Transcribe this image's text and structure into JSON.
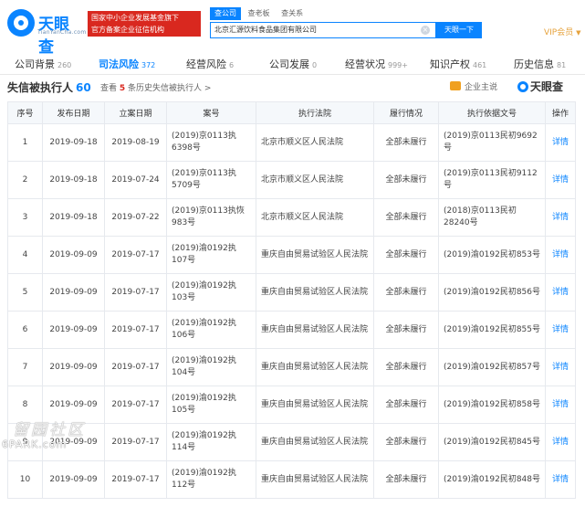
{
  "header": {
    "logo_text": "天眼查",
    "logo_sub": "TianYanCha.com",
    "badge_line1": "国家中小企业发展基金旗下",
    "badge_line2": "官方备案企业征信机构",
    "search_tabs": [
      "查公司",
      "查老板",
      "查关系"
    ],
    "search_value": "北京汇源饮料食品集团有限公司",
    "search_button": "天眼一下",
    "vip": "VIP会员"
  },
  "nav": [
    {
      "label": "公司背景",
      "count": "260"
    },
    {
      "label": "司法风险",
      "count": "372"
    },
    {
      "label": "经营风险",
      "count": "6"
    },
    {
      "label": "公司发展",
      "count": "0"
    },
    {
      "label": "经营状况",
      "count": "999+"
    },
    {
      "label": "知识产权",
      "count": "461"
    },
    {
      "label": "历史信息",
      "count": "81"
    }
  ],
  "section": {
    "title": "失信被执行人",
    "count": "60",
    "hist_pre": "查看",
    "hist_num": "5",
    "hist_post": "条历史失信被执行人 >",
    "enterprise_main": "企业主说",
    "brand": "天眼查"
  },
  "table": {
    "headers": [
      "序号",
      "发布日期",
      "立案日期",
      "案号",
      "执行法院",
      "履行情况",
      "执行依据文号",
      "操作"
    ],
    "rows": [
      {
        "no": "1",
        "pub": "2019-09-18",
        "reg": "2019-08-19",
        "case": "(2019)京0113执6398号",
        "court": "北京市顺义区人民法院",
        "status": "全部未履行",
        "basis": "(2019)京0113民初9692号",
        "op": "详情"
      },
      {
        "no": "2",
        "pub": "2019-09-18",
        "reg": "2019-07-24",
        "case": "(2019)京0113执5709号",
        "court": "北京市顺义区人民法院",
        "status": "全部未履行",
        "basis": "(2019)京0113民初9112号",
        "op": "详情"
      },
      {
        "no": "3",
        "pub": "2019-09-18",
        "reg": "2019-07-22",
        "case": "(2019)京0113执恢983号",
        "court": "北京市顺义区人民法院",
        "status": "全部未履行",
        "basis": "(2018)京0113民初28240号",
        "op": "详情"
      },
      {
        "no": "4",
        "pub": "2019-09-09",
        "reg": "2019-07-17",
        "case": "(2019)渝0192执107号",
        "court": "重庆自由贸易试验区人民法院",
        "status": "全部未履行",
        "basis": "(2019)渝0192民初853号",
        "op": "详情"
      },
      {
        "no": "5",
        "pub": "2019-09-09",
        "reg": "2019-07-17",
        "case": "(2019)渝0192执103号",
        "court": "重庆自由贸易试验区人民法院",
        "status": "全部未履行",
        "basis": "(2019)渝0192民初856号",
        "op": "详情"
      },
      {
        "no": "6",
        "pub": "2019-09-09",
        "reg": "2019-07-17",
        "case": "(2019)渝0192执106号",
        "court": "重庆自由贸易试验区人民法院",
        "status": "全部未履行",
        "basis": "(2019)渝0192民初855号",
        "op": "详情"
      },
      {
        "no": "7",
        "pub": "2019-09-09",
        "reg": "2019-07-17",
        "case": "(2019)渝0192执104号",
        "court": "重庆自由贸易试验区人民法院",
        "status": "全部未履行",
        "basis": "(2019)渝0192民初857号",
        "op": "详情"
      },
      {
        "no": "8",
        "pub": "2019-09-09",
        "reg": "2019-07-17",
        "case": "(2019)渝0192执105号",
        "court": "重庆自由贸易试验区人民法院",
        "status": "全部未履行",
        "basis": "(2019)渝0192民初858号",
        "op": "详情"
      },
      {
        "no": "9",
        "pub": "2019-09-09",
        "reg": "2019-07-17",
        "case": "(2019)渝0192执114号",
        "court": "重庆自由贸易试验区人民法院",
        "status": "全部未履行",
        "basis": "(2019)渝0192民初845号",
        "op": "详情"
      },
      {
        "no": "10",
        "pub": "2019-09-09",
        "reg": "2019-07-17",
        "case": "(2019)渝0192执112号",
        "court": "重庆自由贸易试验区人民法院",
        "status": "全部未履行",
        "basis": "(2019)渝0192民初848号",
        "op": "详情"
      }
    ]
  },
  "watermark": {
    "line1": "留园社区",
    "line2": "6PARK.com"
  },
  "colors": {
    "accent": "#0a84ff",
    "badge": "#d9281f",
    "vip": "#e6a23c"
  }
}
